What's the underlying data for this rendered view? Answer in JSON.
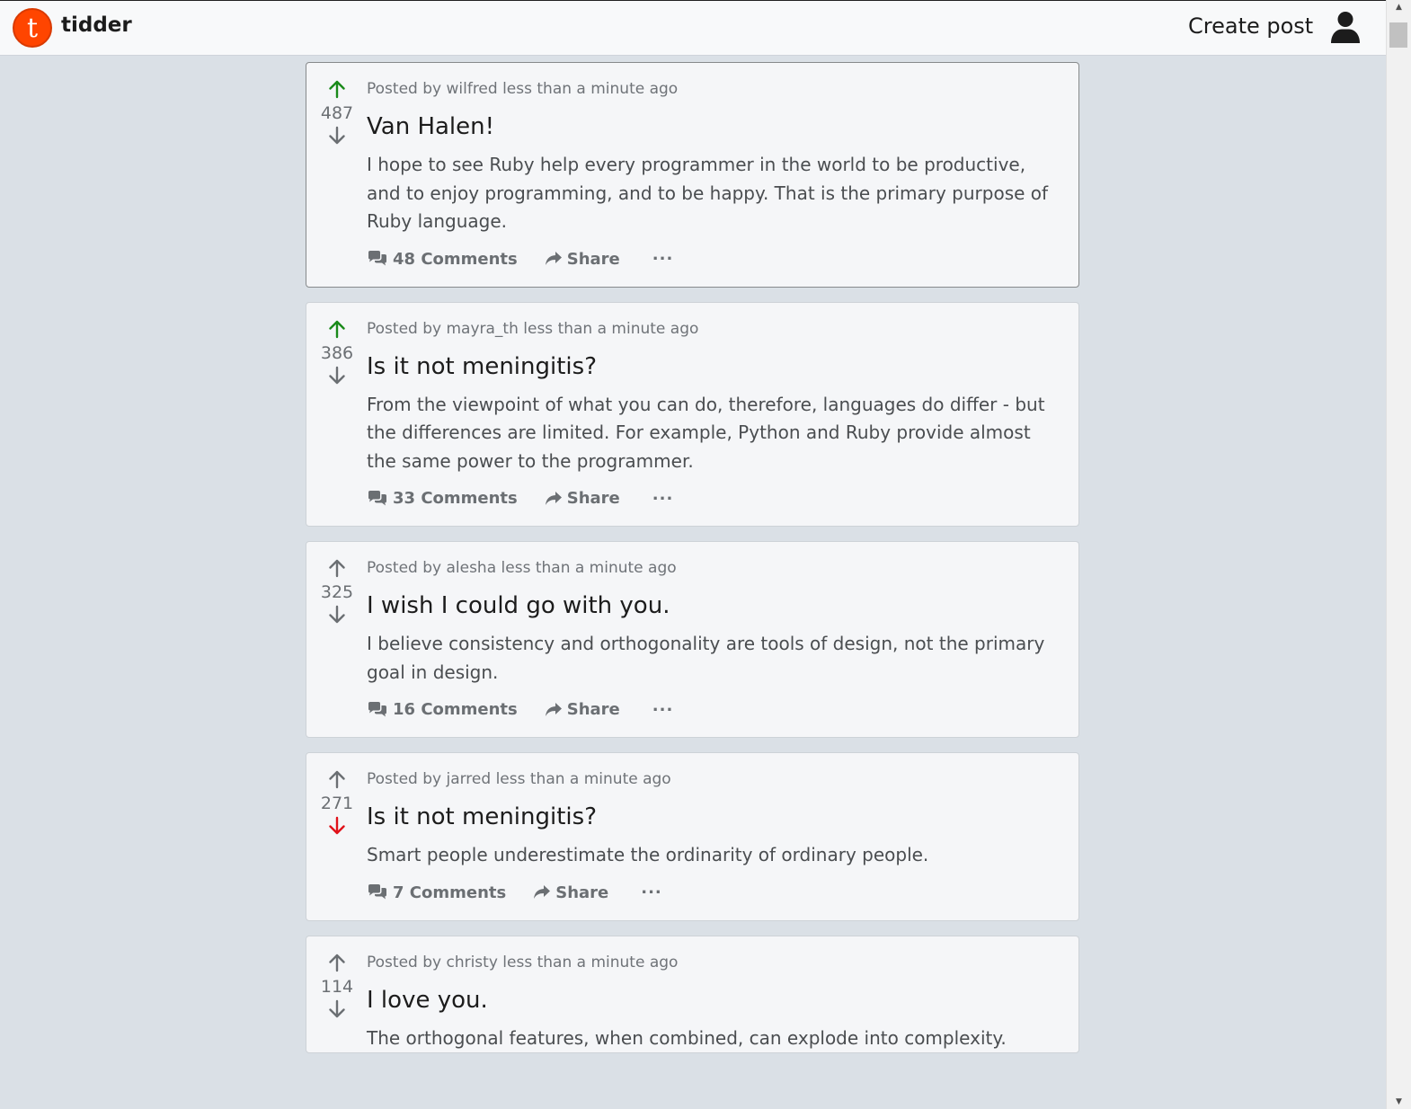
{
  "header": {
    "brand": "tidder",
    "logo_letter": "t",
    "create_post_label": "Create post"
  },
  "colors": {
    "upvote_active": "#1a8a1a",
    "downvote_active": "#e0121a",
    "neutral_arrow": "#6b6f73",
    "logo": "#ff4500"
  },
  "posts": [
    {
      "author_line": "Posted by wilfred less than a minute ago",
      "score": "487",
      "vote": "up",
      "title": "Van Halen!",
      "body": "I hope to see Ruby help every programmer in the world to be productive, and to enjoy programming, and to be happy. That is the primary purpose of Ruby language.",
      "comments": "48 Comments",
      "share": "Share",
      "more": "..."
    },
    {
      "author_line": "Posted by mayra_th less than a minute ago",
      "score": "386",
      "vote": "up",
      "title": "Is it not meningitis?",
      "body": "From the viewpoint of what you can do, therefore, languages do differ - but the differences are limited. For example, Python and Ruby provide almost the same power to the programmer.",
      "comments": "33 Comments",
      "share": "Share",
      "more": "..."
    },
    {
      "author_line": "Posted by alesha less than a minute ago",
      "score": "325",
      "vote": "none",
      "title": "I wish I could go with you.",
      "body": "I believe consistency and orthogonality are tools of design, not the primary goal in design.",
      "comments": "16 Comments",
      "share": "Share",
      "more": "..."
    },
    {
      "author_line": "Posted by jarred less than a minute ago",
      "score": "271",
      "vote": "down",
      "title": "Is it not meningitis?",
      "body": "Smart people underestimate the ordinarity of ordinary people.",
      "comments": "7 Comments",
      "share": "Share",
      "more": "..."
    },
    {
      "author_line": "Posted by christy less than a minute ago",
      "score": "114",
      "vote": "none",
      "title": "I love you.",
      "body": "The orthogonal features, when combined, can explode into complexity.",
      "comments": "",
      "share": "",
      "more": ""
    }
  ]
}
